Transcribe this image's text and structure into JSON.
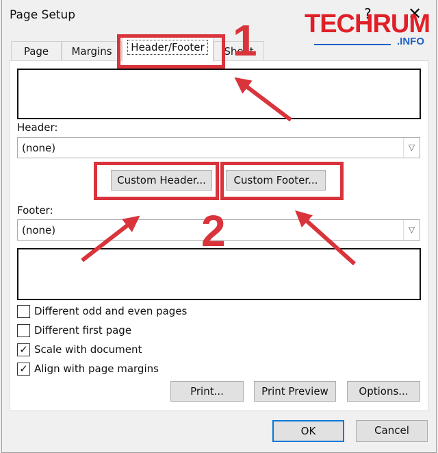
{
  "window": {
    "title": "Page Setup",
    "help": "?",
    "close": "✕"
  },
  "watermark": {
    "brand": "TECHRUM",
    "suffix": ".INFO",
    "colors": {
      "brand": "#e02028",
      "suffix": "#1d5fc4"
    }
  },
  "tabs": [
    {
      "label": "Page"
    },
    {
      "label": "Margins"
    },
    {
      "label": "Header/Footer",
      "selected": true
    },
    {
      "label": "Sheet"
    }
  ],
  "header": {
    "label": "Header:",
    "value": "(none)"
  },
  "footer": {
    "label": "Footer:",
    "value": "(none)"
  },
  "buttons": {
    "custom_header": "Custom Header...",
    "custom_footer": "Custom Footer...",
    "print": "Print...",
    "print_preview": "Print Preview",
    "options": "Options...",
    "ok": "OK",
    "cancel": "Cancel"
  },
  "checkboxes": [
    {
      "label": "Different odd and even pages",
      "checked": false
    },
    {
      "label": "Different first page",
      "checked": false
    },
    {
      "label": "Scale with document",
      "checked": true
    },
    {
      "label": "Align with page margins",
      "checked": true
    }
  ],
  "annotations": {
    "step1": "1",
    "step2": "2",
    "color": "#d9333b"
  }
}
